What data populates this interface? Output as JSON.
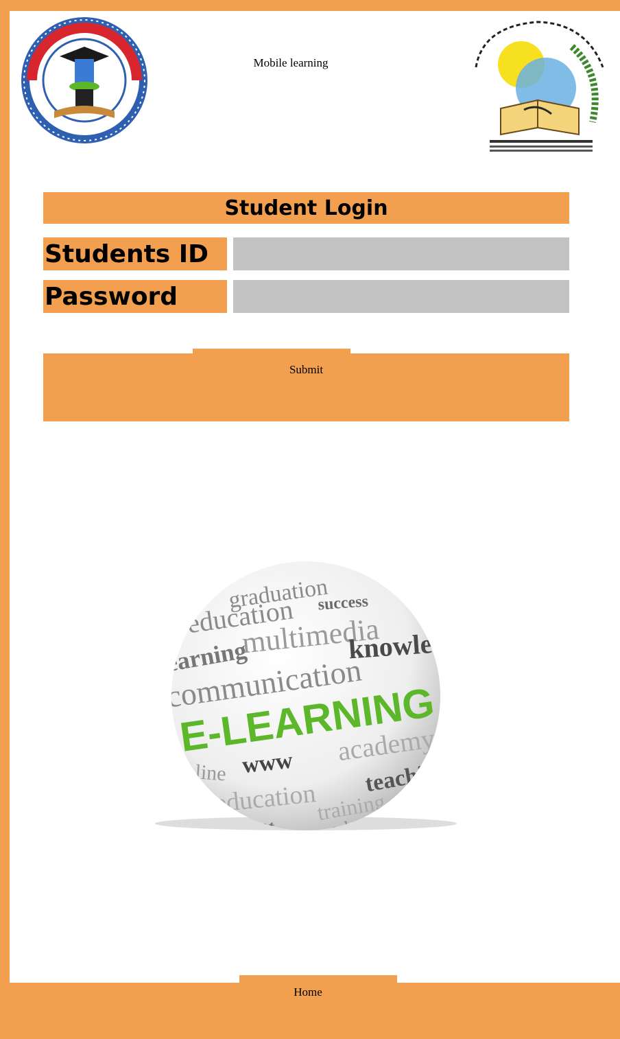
{
  "header": {
    "title": "Mobile learning",
    "left_logo_icon": "university-seal-icon",
    "right_logo_icon": "college-emblem-icon"
  },
  "login": {
    "heading": "Student Login",
    "student_id_label": "Students ID",
    "student_id_value": "",
    "password_label": "Password",
    "password_value": "",
    "submit_label": "Submit"
  },
  "hero": {
    "words": [
      "graduation",
      "success",
      "education",
      "multimedia",
      "learning",
      "knowledge",
      "communication",
      "E-LEARNING",
      "www",
      "academy",
      "online",
      "teaching",
      "education",
      "training",
      "school",
      "concept"
    ]
  },
  "footer": {
    "home_label": "Home"
  },
  "colors": {
    "accent": "#f2a04f",
    "input_bg": "#c3c3c3",
    "elearning_green": "#5cb82a"
  }
}
